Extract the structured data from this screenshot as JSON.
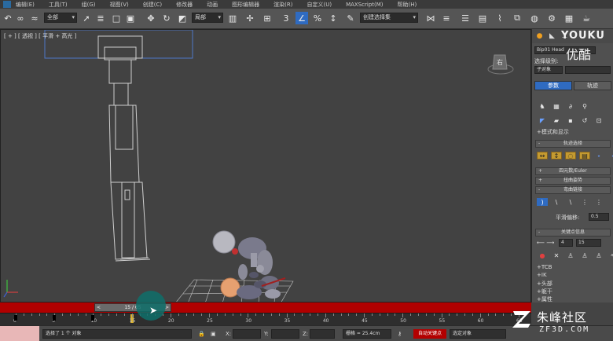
{
  "menu": {
    "items": [
      "编辑(E)",
      "工具(T)",
      "组(G)",
      "视图(V)",
      "创建(C)",
      "修改器",
      "动画",
      "图形编辑器",
      "渲染(R)",
      "自定义(U)",
      "MAXScript(M)",
      "帮助(H)"
    ]
  },
  "toolbar": {
    "selection_filter": "全部",
    "ref_coord": "局部",
    "named_selection": "创建选择集"
  },
  "viewport": {
    "label": "[ + ] [ 透视 ] [ 平滑 + 高光 ]",
    "viewcube_label": "右"
  },
  "command_panel": {
    "object_name": "Bip01 Head",
    "level_label": "选择级别:",
    "sub_object": "子对象",
    "tab_params": "参数",
    "tab_track": "轨迹",
    "rollout_modes": "模式和显示",
    "rollout_track_select": "轨迹选择",
    "rollout_quat": "四元数/Euler",
    "rollout_twist": "扭曲姿势",
    "rollout_bend": "弯曲链接",
    "smooth_label": "平滑偏移:",
    "smooth_value": "0.5",
    "rollout_key_info": "关键点信息",
    "key_index": "4",
    "key_time": "15",
    "sub_rollouts": [
      "TCB",
      "IK",
      "头部",
      "躯干",
      "属性"
    ]
  },
  "watermarks": {
    "youku_en": "YOUKU",
    "youku_cn": "优酷",
    "zf_cn": "朱峰社区",
    "zf_en": "ZF3D.COM"
  },
  "timeline": {
    "slider_text": "15 / 65",
    "tick_labels": [
      "0",
      "5",
      "10",
      "15",
      "20",
      "25",
      "30",
      "35",
      "40",
      "45",
      "50",
      "55",
      "60",
      "65"
    ],
    "current_frame": 15,
    "total_frames": 65
  },
  "status": {
    "selection_text": "选择了 1 个 对象",
    "x_label": "X:",
    "y_label": "Y:",
    "z_label": "Z:",
    "grid_text": "栅格 = 25.4cm",
    "auto_key": "自动关键点",
    "set_key_filter": "选定对象"
  },
  "colors": {
    "accent_blue": "#2f6bc1",
    "timeline_red": "#b00000",
    "viewport_bg": "#424242"
  }
}
